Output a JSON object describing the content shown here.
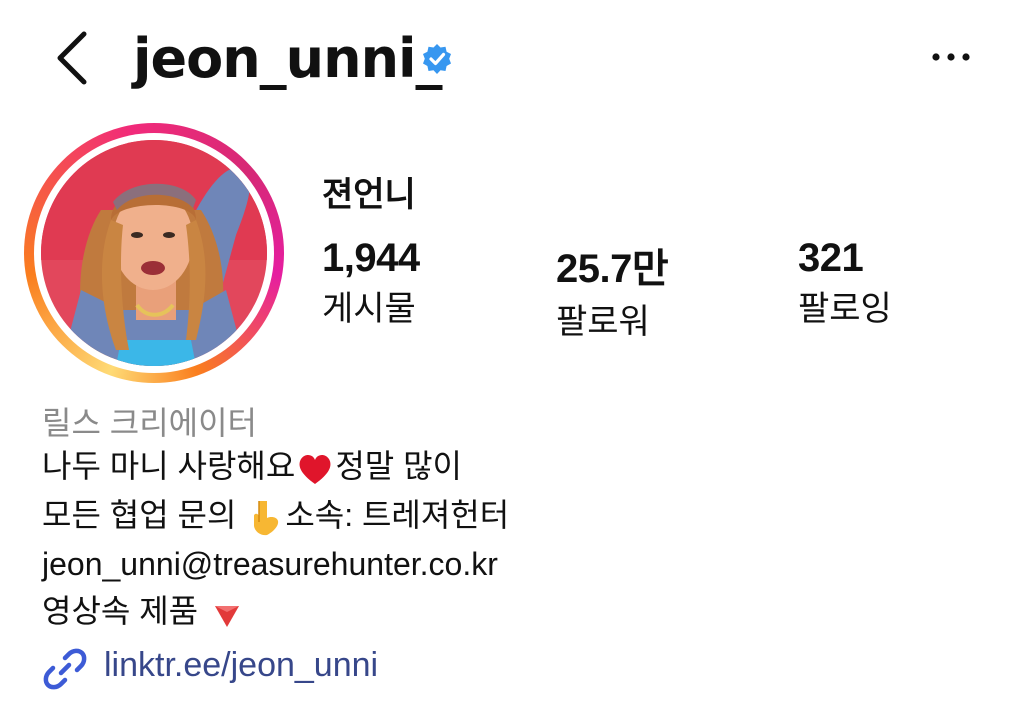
{
  "header": {
    "username": "jeon_unni_",
    "icons": {
      "back": "chevron-left-icon",
      "verified": "verified-badge-icon",
      "more": "more-horizontal-icon"
    },
    "colors": {
      "verified": "#3797f0"
    }
  },
  "profile": {
    "display_name": "젼언니",
    "stats": [
      {
        "value": "1,944",
        "label": "게시물"
      },
      {
        "value": "25.7만",
        "label": "팔로워"
      },
      {
        "value": "321",
        "label": "팔로잉"
      }
    ],
    "category": "릴스 크리에이터",
    "bio": {
      "line1_a": "나두 마니 사랑해요",
      "line1_emoji": "heart-emoji",
      "line1_b": "정말 많이",
      "line2_a": "모든 협업 문의",
      "line2_emoji": "pointing-down-emoji",
      "line2_b": "소속: 트레져헌터",
      "line3": "jeon_unni@treasurehunter.co.kr",
      "line4_a": "영상속 제품",
      "line4_emoji": "red-triangle-down-emoji"
    },
    "link": {
      "text": "linktr.ee/jeon_unni",
      "icon": "link-icon",
      "color": "#37478a"
    },
    "colors": {
      "ring_start": "#feda75",
      "ring_mid": "#d62976",
      "ring_end": "#fa7e1e"
    }
  }
}
